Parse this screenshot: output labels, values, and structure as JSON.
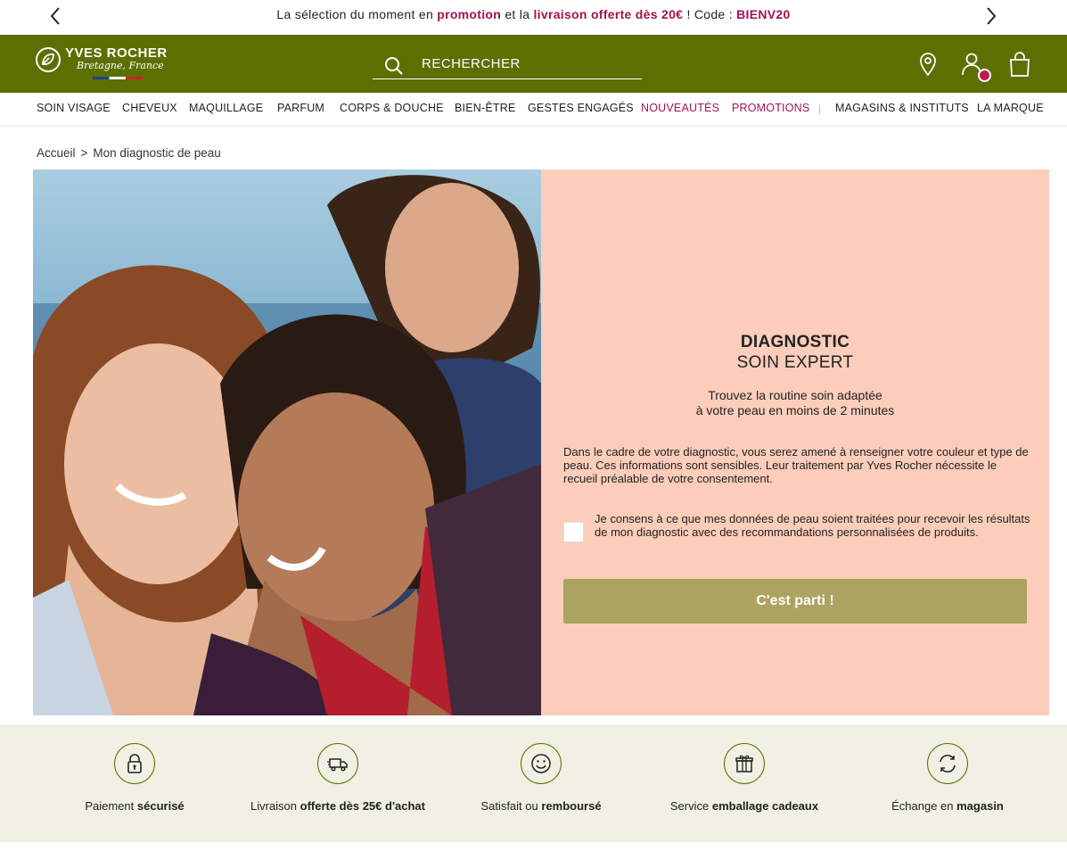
{
  "promo": {
    "t1": "La sélection du moment en ",
    "t2": "promotion",
    "t3": " et la ",
    "t4": "livraison offerte dès 20€",
    "t5": " ! Code : ",
    "t6": "BIENV20"
  },
  "header": {
    "brand": "YVES ROCHER",
    "tagline": "Bretagne, France",
    "search_label": "RECHERCHER"
  },
  "nav": {
    "items": [
      "SOIN VISAGE",
      "CHEVEUX",
      "MAQUILLAGE",
      "PARFUM",
      "CORPS & DOUCHE",
      "BIEN-ÊTRE",
      "GESTES ENGAGÉS",
      "NOUVEAUTÉS",
      "PROMOTIONS",
      "MAGASINS & INSTITUTS",
      "LA MARQUE"
    ]
  },
  "breadcrumb": {
    "home": "Accueil",
    "separator": ">",
    "current": "Mon diagnostic de peau"
  },
  "panel": {
    "title": "DIAGNOSTIC",
    "subtitle": "SOIN EXPERT",
    "tagline_1": "Trouvez la routine soin adaptée",
    "tagline_2": "à votre peau en moins de 2 minutes",
    "info": "Dans le cadre de votre diagnostic, vous serez amené à renseigner votre couleur et type de peau. Ces informations sont sensibles. Leur traitement par Yves Rocher nécessite le recueil préalable de votre consentement.",
    "consent": "Je consens à ce que mes données de peau soient traitées pour recevoir les résultats de mon diagnostic avec des recommandations personnalisées de produits.",
    "cta": "C'est parti !"
  },
  "reassurance": [
    {
      "pre": "Paiement ",
      "bold": "sécurisé",
      "post": "",
      "icon": "lock-icon"
    },
    {
      "pre": "Livraison ",
      "bold": "offerte dès 25€ d'achat",
      "post": "",
      "icon": "truck-icon"
    },
    {
      "pre": "Satisfait ou ",
      "bold": "remboursé",
      "post": "",
      "icon": "smile-icon"
    },
    {
      "pre": "Service ",
      "bold": "emballage cadeaux",
      "post": "",
      "icon": "gift-icon"
    },
    {
      "pre": "Échange en ",
      "bold": "magasin",
      "post": "",
      "icon": "exchange-icon"
    }
  ],
  "colors": {
    "brand_green": "#5b7000",
    "accent_pink": "#a3134d",
    "panel_bg": "#fccdbb",
    "cta_bg": "#aba35f",
    "band_bg": "#f0f0e4"
  }
}
